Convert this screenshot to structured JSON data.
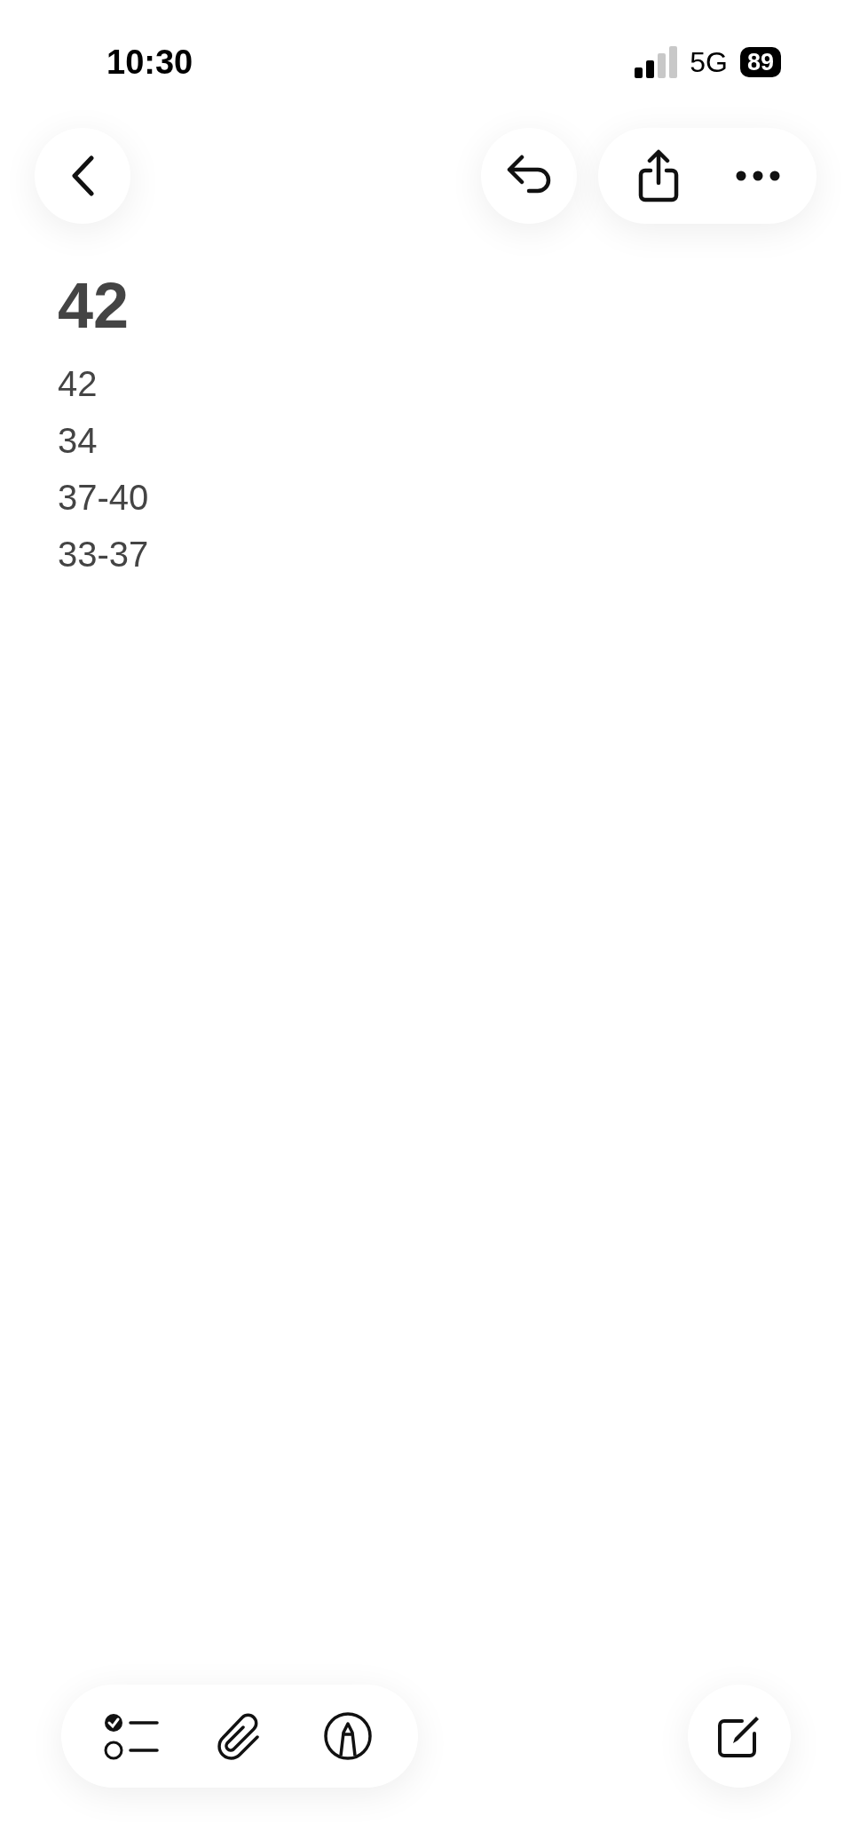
{
  "status_bar": {
    "time": "10:30",
    "network": "5G",
    "battery": "89"
  },
  "note": {
    "title": "42",
    "lines": [
      "42",
      "34",
      "37-40",
      "33-37"
    ]
  }
}
